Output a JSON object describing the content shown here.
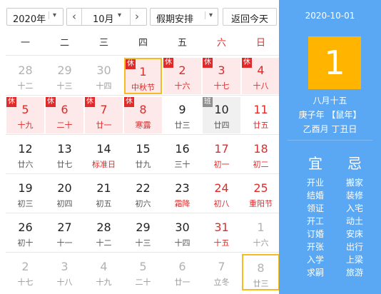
{
  "toolbar": {
    "year_value": "2020年",
    "prev_month_icon": "‹",
    "month_value": "10月",
    "next_month_icon": "›",
    "holiday_value": "假期安排",
    "dropdown_icon": "▾",
    "today_label": "返回今天"
  },
  "weekdays": [
    "一",
    "二",
    "三",
    "四",
    "五",
    "六",
    "日"
  ],
  "rows": [
    [
      {
        "d": "28",
        "l": "十二",
        "t": "grey"
      },
      {
        "d": "29",
        "l": "十三",
        "t": "grey"
      },
      {
        "d": "30",
        "l": "十四",
        "t": "grey"
      },
      {
        "d": "1",
        "l": "中秋节",
        "t": "hol red sel",
        "tag": "休"
      },
      {
        "d": "2",
        "l": "十六",
        "t": "hol red",
        "tag": "休"
      },
      {
        "d": "3",
        "l": "十七",
        "t": "hol red",
        "tag": "休"
      },
      {
        "d": "4",
        "l": "十八",
        "t": "hol red",
        "tag": "休"
      }
    ],
    [
      {
        "d": "5",
        "l": "十九",
        "t": "hol red",
        "tag": "休"
      },
      {
        "d": "6",
        "l": "二十",
        "t": "hol red",
        "tag": "休"
      },
      {
        "d": "7",
        "l": "廿一",
        "t": "hol red",
        "tag": "休"
      },
      {
        "d": "8",
        "l": "寒露",
        "t": "hol red",
        "tag": "休"
      },
      {
        "d": "9",
        "l": "廿三",
        "t": ""
      },
      {
        "d": "10",
        "l": "廿四",
        "t": "work",
        "tag": "班"
      },
      {
        "d": "11",
        "l": "廿五",
        "t": "red"
      }
    ],
    [
      {
        "d": "12",
        "l": "廿六",
        "t": ""
      },
      {
        "d": "13",
        "l": "廿七",
        "t": ""
      },
      {
        "d": "14",
        "l": "标准日",
        "t": "fest"
      },
      {
        "d": "15",
        "l": "廿九",
        "t": ""
      },
      {
        "d": "16",
        "l": "三十",
        "t": ""
      },
      {
        "d": "17",
        "l": "初一",
        "t": "red"
      },
      {
        "d": "18",
        "l": "初二",
        "t": "red"
      }
    ],
    [
      {
        "d": "19",
        "l": "初三",
        "t": ""
      },
      {
        "d": "20",
        "l": "初四",
        "t": ""
      },
      {
        "d": "21",
        "l": "初五",
        "t": ""
      },
      {
        "d": "22",
        "l": "初六",
        "t": ""
      },
      {
        "d": "23",
        "l": "霜降",
        "t": "fest"
      },
      {
        "d": "24",
        "l": "初八",
        "t": "red"
      },
      {
        "d": "25",
        "l": "重阳节",
        "t": "red"
      }
    ],
    [
      {
        "d": "26",
        "l": "初十",
        "t": ""
      },
      {
        "d": "27",
        "l": "十一",
        "t": ""
      },
      {
        "d": "28",
        "l": "十二",
        "t": ""
      },
      {
        "d": "29",
        "l": "十三",
        "t": ""
      },
      {
        "d": "30",
        "l": "十四",
        "t": ""
      },
      {
        "d": "31",
        "l": "十五",
        "t": "red"
      },
      {
        "d": "1",
        "l": "十六",
        "t": "grey"
      }
    ],
    [
      {
        "d": "2",
        "l": "十七",
        "t": "grey"
      },
      {
        "d": "3",
        "l": "十八",
        "t": "grey"
      },
      {
        "d": "4",
        "l": "十九",
        "t": "grey"
      },
      {
        "d": "5",
        "l": "二十",
        "t": "grey"
      },
      {
        "d": "6",
        "l": "廿一",
        "t": "grey"
      },
      {
        "d": "7",
        "l": "立冬",
        "t": "grey"
      },
      {
        "d": "8",
        "l": "廿三",
        "t": "grey sel"
      }
    ]
  ],
  "side": {
    "date": "2020-10-01",
    "day": "1",
    "lunar": "八月十五",
    "year_zodiac": "庚子年 【鼠年】",
    "month_day": "乙酉月 丁丑日",
    "yi_title": "宜",
    "ji_title": "忌",
    "yi": [
      "开业",
      "结婚",
      "领证",
      "开工",
      "订婚",
      "开张",
      "入学",
      "求嗣"
    ],
    "ji": [
      "搬家",
      "装修",
      "入宅",
      "动土",
      "安床",
      "出行",
      "上梁",
      "旅游"
    ]
  },
  "colors": {
    "panel": "#5aa8f3",
    "highlight": "#ffb500",
    "holiday_bg": "#fde9e9",
    "holiday_red": "#e02a2a",
    "selected_border": "#f6bb1c"
  }
}
